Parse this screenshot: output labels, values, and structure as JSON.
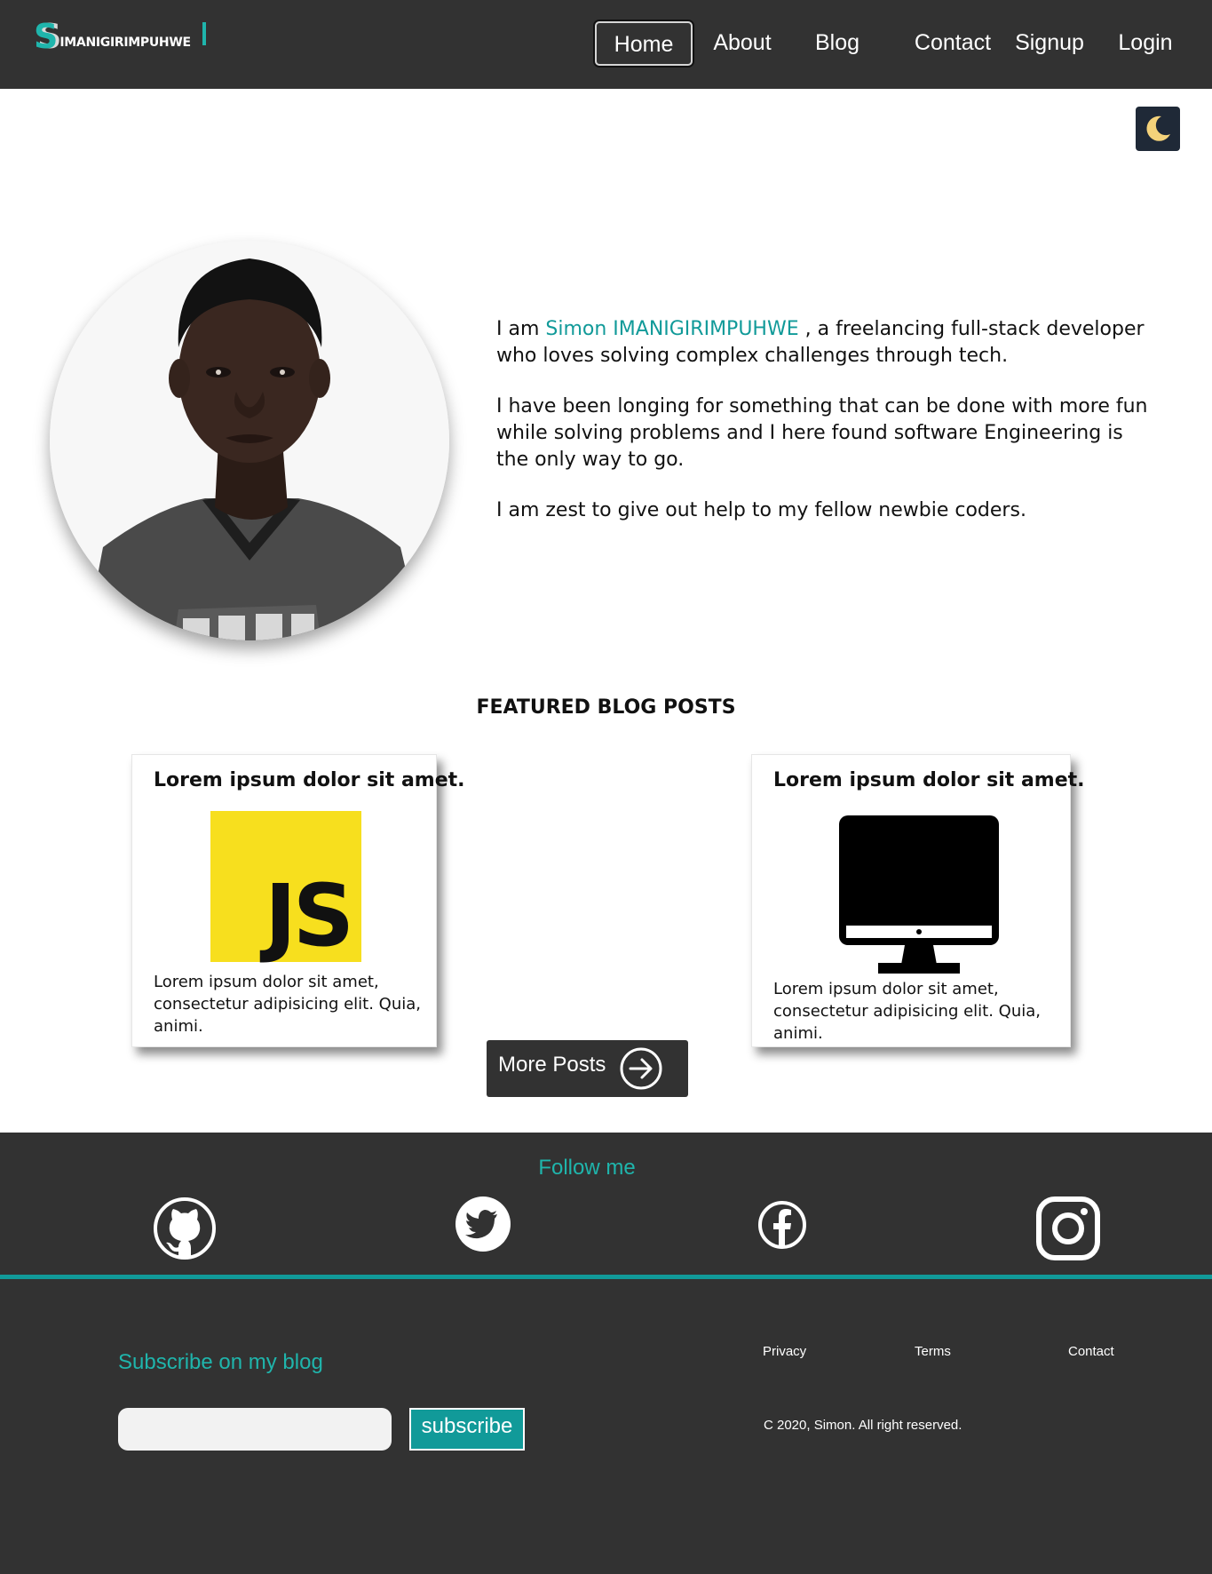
{
  "header": {
    "logo_initial": "S",
    "logo_rest": "IMANIGIRIMPUHWE",
    "nav": [
      "Home",
      "About",
      "Blog",
      "Contact",
      "Signup",
      "Login"
    ],
    "active_nav": "Home"
  },
  "theme_toggle": {
    "icon": "moon-icon",
    "icon_color": "#f4d27a",
    "bg_color": "#1f2937"
  },
  "hero": {
    "intro_prefix": "I am ",
    "name": "Simon IMANIGIRIMPUHWE",
    "intro_suffix": " , a freelancing full-stack developer who loves solving complex challenges through tech.",
    "paragraph2": "I have been longing for something that can be done with more fun while solving problems and I here found software Engineering is the only way to go.",
    "paragraph3": "I am zest to give out help to my fellow newbie coders."
  },
  "featured": {
    "title": "FEATURED BLOG POSTS",
    "posts": [
      {
        "title": "Lorem ipsum dolor sit amet.",
        "image": "javascript-logo",
        "logo_text": "JS",
        "text": "Lorem ipsum dolor sit amet, consectetur adipisicing elit. Quia, animi."
      },
      {
        "title": "Lorem ipsum dolor sit amet.",
        "image": "monitor-icon",
        "text": "Lorem ipsum dolor sit amet, consectetur adipisicing elit. Quia, animi."
      }
    ],
    "more_label": "More Posts"
  },
  "footer": {
    "follow_title": "Follow me",
    "social": [
      "github-icon",
      "twitter-icon",
      "facebook-icon",
      "instagram-icon"
    ],
    "subscribe_title": "Subscribe on my blog",
    "subscribe_placeholder": "",
    "subscribe_button": "subscribe",
    "links": [
      "Privacy",
      "Terms",
      "Contact"
    ],
    "copyright": "C 2020, Simon. All right reserved."
  },
  "colors": {
    "header_bg": "#323232",
    "accent": "#1fb5ac",
    "accent_dark": "#119a99",
    "js_yellow": "#f7df1e"
  }
}
